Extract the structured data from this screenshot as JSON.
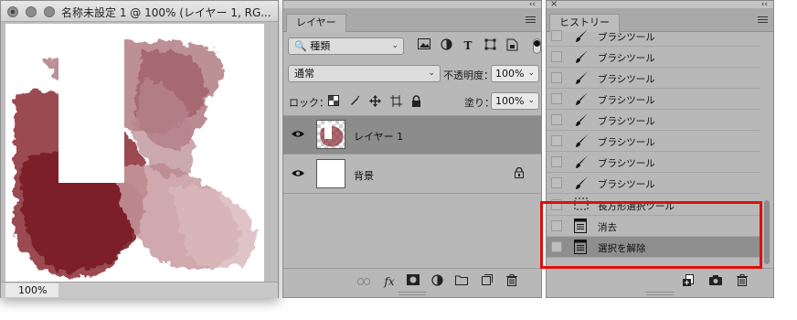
{
  "document": {
    "title": "名称未設定 1 @ 100% (レイヤー 1, RG...",
    "zoom": "100%"
  },
  "layers_panel": {
    "tab_label": "レイヤー",
    "filter": {
      "label": "種類"
    },
    "blend_mode": "通常",
    "opacity_label": "不透明度：",
    "opacity_value": "100%",
    "lock_label": "ロック：",
    "fill_label": "塗り：",
    "fill_value": "100%",
    "layers": [
      {
        "name": "レイヤー 1",
        "selected": true
      },
      {
        "name": "背景",
        "selected": false,
        "locked": true
      }
    ],
    "footer_icons": [
      "link-icon",
      "fx-icon",
      "mask-icon",
      "adjustment-icon",
      "folder-icon",
      "new-layer-icon",
      "trash-icon"
    ]
  },
  "history_panel": {
    "tab_label": "ヒストリー",
    "items": [
      {
        "label": "ブラシツール",
        "icon": "brush-icon"
      },
      {
        "label": "ブラシツール",
        "icon": "brush-icon"
      },
      {
        "label": "ブラシツール",
        "icon": "brush-icon"
      },
      {
        "label": "ブラシツール",
        "icon": "brush-icon"
      },
      {
        "label": "ブラシツール",
        "icon": "brush-icon"
      },
      {
        "label": "ブラシツール",
        "icon": "brush-icon"
      },
      {
        "label": "ブラシツール",
        "icon": "brush-icon"
      },
      {
        "label": "ブラシツール",
        "icon": "brush-icon"
      },
      {
        "label": "長方形選択ツール",
        "icon": "marquee-icon"
      },
      {
        "label": "消去",
        "icon": "document-icon"
      },
      {
        "label": "選択を解除",
        "icon": "document-icon",
        "selected": true
      }
    ],
    "footer_icons": [
      "new-document-from-state-icon",
      "snapshot-camera-icon",
      "trash-icon"
    ]
  },
  "colors": {
    "paint": "#8a2a33",
    "paint_light": "#c79a9f",
    "highlight_box": "#e00d0d",
    "panel_bg": "#b8b8b8"
  }
}
